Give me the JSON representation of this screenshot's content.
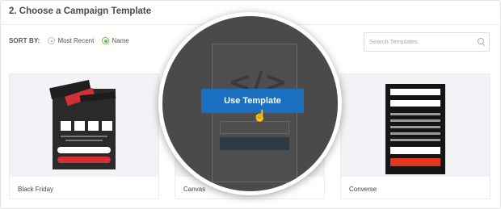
{
  "header": {
    "title": "2. Choose a Campaign Template"
  },
  "sort": {
    "label": "SORT BY:",
    "options": [
      {
        "label": "Most Recent",
        "selected": false
      },
      {
        "label": "Name",
        "selected": true
      }
    ]
  },
  "search": {
    "placeholder": "Search Templates",
    "icon": "search-icon"
  },
  "templates": [
    {
      "name": "Black Friday"
    },
    {
      "name": "Canvas"
    },
    {
      "name": "Converse"
    }
  ],
  "overlay": {
    "button_label": "Use Template",
    "code_glyph": "</>"
  },
  "colors": {
    "accent_blue": "#1a6fc1",
    "radio_green": "#6cc04a",
    "red": "#d42f37"
  }
}
